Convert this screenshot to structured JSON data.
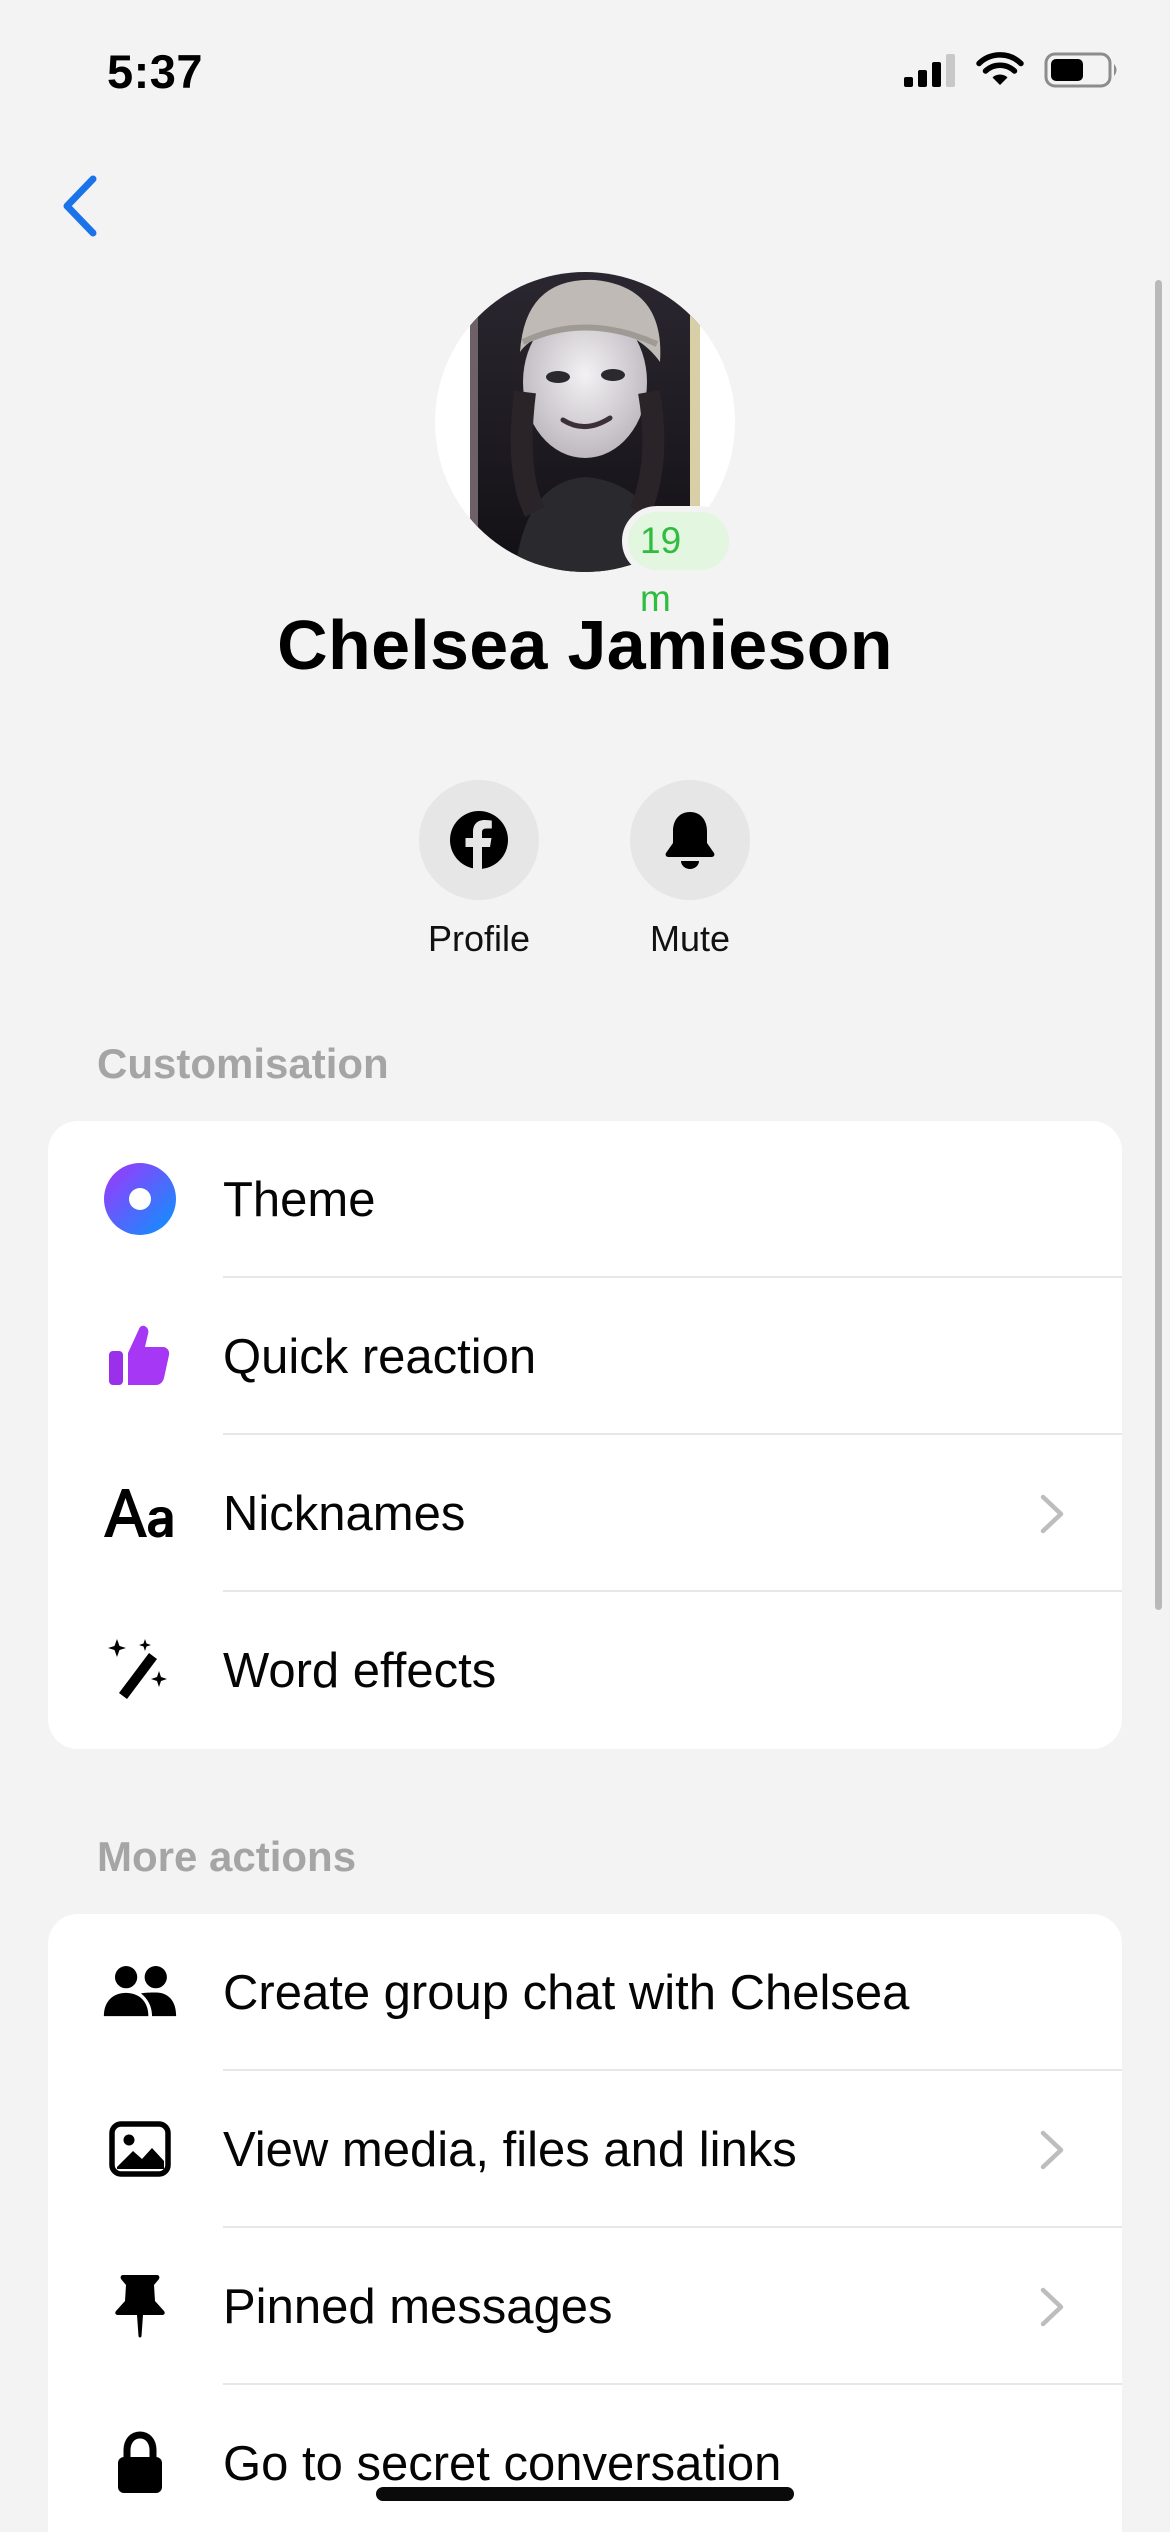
{
  "status_bar": {
    "time": "5:37",
    "icons": [
      "cellular-signal-icon",
      "wifi-icon",
      "battery-icon"
    ],
    "battery_level": 0.6
  },
  "header": {
    "back_icon": "chevron-left-icon",
    "accent_color": "#1a73e8"
  },
  "contact": {
    "name": "Chelsea Jamieson",
    "presence": "19 m",
    "presence_color": "#2fbc3f"
  },
  "quick_actions": [
    {
      "label": "Profile",
      "icon": "facebook-icon"
    },
    {
      "label": "Mute",
      "icon": "bell-icon"
    }
  ],
  "customisation": {
    "header": "Customisation",
    "items": [
      {
        "label": "Theme",
        "icon": "theme-icon",
        "chevron": false
      },
      {
        "label": "Quick reaction",
        "icon": "thumbs-up-icon",
        "chevron": false
      },
      {
        "label": "Nicknames",
        "icon": "text-aa-icon",
        "chevron": true
      },
      {
        "label": "Word effects",
        "icon": "magic-wand-icon",
        "chevron": false
      }
    ]
  },
  "more_actions": {
    "header": "More actions",
    "items": [
      {
        "label": "Create group chat with Chelsea",
        "icon": "people-icon",
        "chevron": false
      },
      {
        "label": "View media, files and links",
        "icon": "image-icon",
        "chevron": true
      },
      {
        "label": "Pinned messages",
        "icon": "pin-icon",
        "chevron": true
      },
      {
        "label": "Go to secret conversation",
        "icon": "lock-icon",
        "chevron": false
      }
    ]
  }
}
